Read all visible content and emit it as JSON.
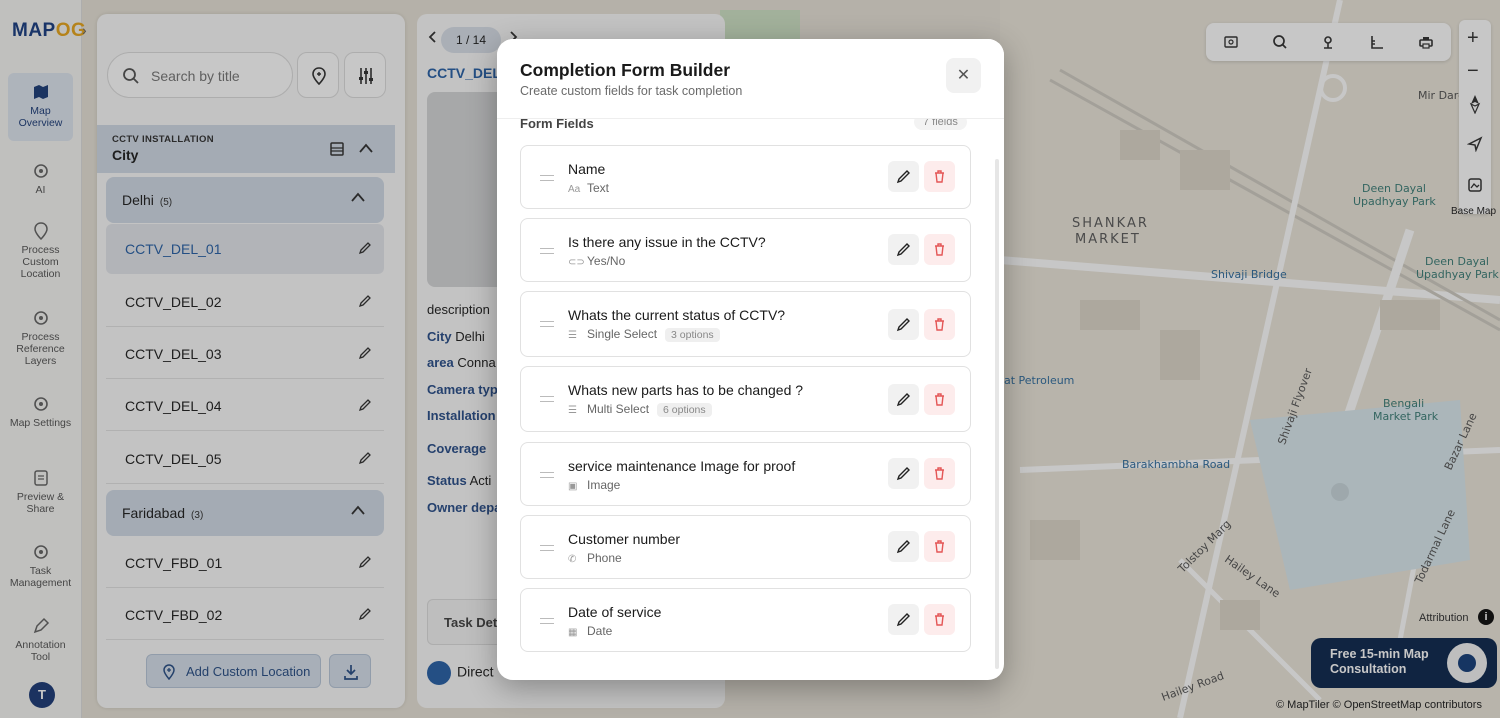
{
  "app": {
    "logo_main": "MAP",
    "logo_accent": "OG"
  },
  "rail": [
    {
      "label": "Map Overview",
      "icon": "map-icon",
      "active": true
    },
    {
      "label": "AI",
      "icon": "gear-icon"
    },
    {
      "label": "Process Custom Location",
      "icon": "location-pin-icon"
    },
    {
      "label": "Process Reference Layers",
      "icon": "gear-icon"
    },
    {
      "label": "Map Settings",
      "icon": "gear-icon"
    },
    {
      "label": "Preview & Share",
      "icon": "document-icon"
    },
    {
      "label": "Task Management",
      "icon": "gear-icon"
    },
    {
      "label": "Annotation Tool",
      "icon": "pen-tool-icon"
    }
  ],
  "user": {
    "avatar_initial": "T"
  },
  "locations": {
    "search_placeholder": "Search by title",
    "category_caption": "CCTV INSTALLATION",
    "category_title": "City",
    "groups": [
      {
        "name": "Delhi",
        "count": "(5)",
        "items": [
          "CCTV_DEL_01",
          "CCTV_DEL_02",
          "CCTV_DEL_03",
          "CCTV_DEL_04",
          "CCTV_DEL_05"
        ]
      },
      {
        "name": "Faridabad",
        "count": "(3)",
        "items": [
          "CCTV_FBD_01",
          "CCTV_FBD_02"
        ]
      }
    ],
    "add_button": "Add Custom Location"
  },
  "detail": {
    "pager": "1 / 14",
    "title": "CCTV_DEL",
    "rows": [
      {
        "label": "",
        "value": "description"
      },
      {
        "label": "City",
        "value": "Delhi"
      },
      {
        "label": "area",
        "value": "Conna"
      },
      {
        "label": "Camera typ",
        "value": ""
      },
      {
        "label": "Installation",
        "value": ""
      },
      {
        "label": "Coverage",
        "value": ""
      },
      {
        "label": "Status",
        "value": "Acti"
      },
      {
        "label": "Owner depa",
        "value": ""
      }
    ],
    "task_tab": "Task Det",
    "directions": "Direct"
  },
  "map": {
    "labels": [
      {
        "text": "SHANKAR",
        "cls": "big"
      },
      {
        "text": "MARKET",
        "cls": "big"
      },
      {
        "text": "Deen Dayal",
        "cls": "teal"
      },
      {
        "text": "Upadhyay Park",
        "cls": "teal"
      },
      {
        "text": "Deen Dayal",
        "cls": "teal"
      },
      {
        "text": "Upadhyay Park",
        "cls": "teal"
      },
      {
        "text": "Shivaji Bridge",
        "cls": "blue"
      },
      {
        "text": "Bengali",
        "cls": "teal"
      },
      {
        "text": "Market Park",
        "cls": "teal"
      },
      {
        "text": "Barakhambha Road",
        "cls": "blue"
      },
      {
        "text": "at Petroleum",
        "cls": "blue"
      },
      {
        "text": "Mir Dard",
        "cls": ""
      },
      {
        "text": "Tolstoy Marg",
        "cls": ""
      },
      {
        "text": "Hailey Lane",
        "cls": ""
      },
      {
        "text": "Hailey Road",
        "cls": ""
      },
      {
        "text": "Todarmal Lane",
        "cls": ""
      },
      {
        "text": "Bazar Lane",
        "cls": ""
      },
      {
        "text": "Shivaji Flyover",
        "cls": ""
      }
    ],
    "base_map_label": "Base Map",
    "attribution": "Attribution",
    "consult_line1": "Free 15-min Map",
    "consult_line2": "Consultation",
    "copyright": "© MapTiler © OpenStreetMap contributors"
  },
  "modal": {
    "title": "Completion Form Builder",
    "subtitle": "Create custom fields for task completion",
    "section_label": "Form Fields",
    "field_count": "7 fields",
    "fields": [
      {
        "name": "Name",
        "type": "Text",
        "type_icon": "Aa",
        "options": ""
      },
      {
        "name": "Is there any issue in the CCTV?",
        "type": "Yes/No",
        "type_icon": "toggle-icon",
        "options": ""
      },
      {
        "name": "Whats the current status of CCTV?",
        "type": "Single Select",
        "type_icon": "list-icon",
        "options": "3 options"
      },
      {
        "name": "Whats new parts has to be changed ?",
        "type": "Multi Select",
        "type_icon": "list-icon",
        "options": "6 options"
      },
      {
        "name": "service maintenance Image for proof",
        "type": "Image",
        "type_icon": "image-icon",
        "options": ""
      },
      {
        "name": "Customer number",
        "type": "Phone",
        "type_icon": "phone-icon",
        "options": ""
      },
      {
        "name": "Date of service",
        "type": "Date",
        "type_icon": "calendar-icon",
        "options": ""
      }
    ]
  },
  "colors": {
    "primary": "#1d3c78",
    "accent": "#e8a61e",
    "danger": "#e45656",
    "highlight": "#d2dbe7"
  }
}
